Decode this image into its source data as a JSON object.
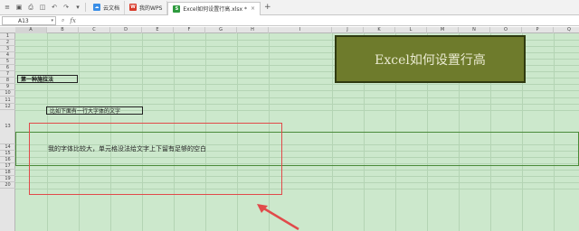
{
  "toolbar": {
    "tabs": [
      {
        "label": "云文档",
        "icon": "cloud-icon",
        "color": "#3a8ee6"
      },
      {
        "label": "我的WPS",
        "icon": "wps-icon",
        "color": "#d83b2b"
      },
      {
        "label": "Excel如何设置行高.xlsx *",
        "icon": "spreadsheet-icon",
        "color": "#2e9a3e"
      }
    ],
    "new_tab": "+"
  },
  "formula_bar": {
    "cell_ref": "A13",
    "fx": "fx"
  },
  "columns": [
    "A",
    "B",
    "C",
    "D",
    "E",
    "F",
    "G",
    "H",
    "I",
    "J",
    "K",
    "L",
    "M",
    "N",
    "O",
    "P",
    "Q"
  ],
  "rows": [
    "1",
    "2",
    "3",
    "4",
    "5",
    "6",
    "7",
    "8",
    "9",
    "10",
    "11",
    "12",
    "13",
    "14",
    "15",
    "16",
    "17",
    "18",
    "19",
    "20"
  ],
  "cells": {
    "title": "Excel如何设置行高",
    "method": "第一种施拉法",
    "example": "比如下面有一行大字体的文字",
    "row13_text": "我的字体比较大，单元格没法给文字上下留有足够的空白"
  },
  "colors": {
    "sheet_bg": "#cce8cc",
    "title_bg": "#6e7b2c",
    "title_text": "#e9e9d0",
    "annotation": "#e14a4a",
    "row_highlight": "#4a8a3a"
  }
}
